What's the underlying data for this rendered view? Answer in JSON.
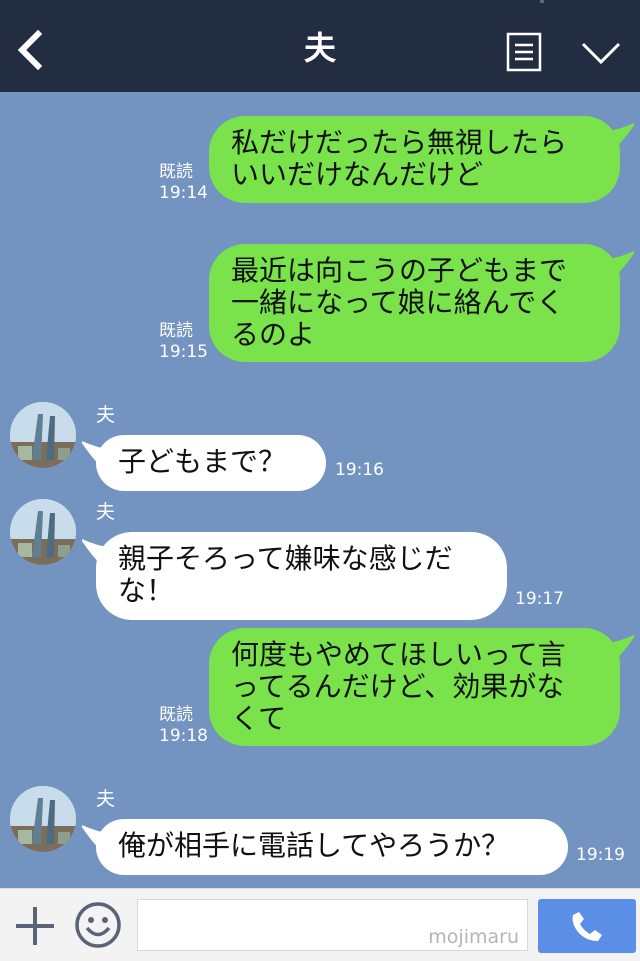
{
  "header": {
    "title": "夫"
  },
  "messages": [
    {
      "side": "me",
      "lines": [
        "私だけだったら無視したら",
        "いいだけなんだけど"
      ],
      "read": "既読",
      "time": "19:14"
    },
    {
      "side": "me",
      "lines": [
        "最近は向こうの子どもまで",
        "一緒になって娘に絡んでく",
        "るのよ"
      ],
      "read": "既読",
      "time": "19:15"
    },
    {
      "side": "them",
      "sender": "夫",
      "lines": [
        "子どもまで？"
      ],
      "time": "19:16"
    },
    {
      "side": "them",
      "sender": "夫",
      "lines": [
        "親子そろって嫌味な感じだ",
        "な！"
      ],
      "time": "19:17"
    },
    {
      "side": "me",
      "lines": [
        "何度もやめてほしいって言",
        "ってるんだけど、効果がな",
        "くて"
      ],
      "read": "既読",
      "time": "19:18"
    },
    {
      "side": "them",
      "sender": "夫",
      "lines": [
        "俺が相手に電話してやろうか？"
      ],
      "time": "19:19"
    }
  ],
  "footer": {
    "input_value": "",
    "watermark": "mojimaru"
  },
  "colors": {
    "header_bg": "#232d42",
    "chat_bg": "#7393c0",
    "my_bubble": "#7ae24a",
    "their_bubble": "#ffffff",
    "call_button": "#5b8ee6"
  },
  "icons": {
    "back": "back-icon",
    "menu": "menu-icon",
    "collapse": "chevron-down-icon",
    "plus": "plus-icon",
    "emoji": "smile-icon",
    "call": "phone-icon",
    "avatar": "avatar"
  }
}
